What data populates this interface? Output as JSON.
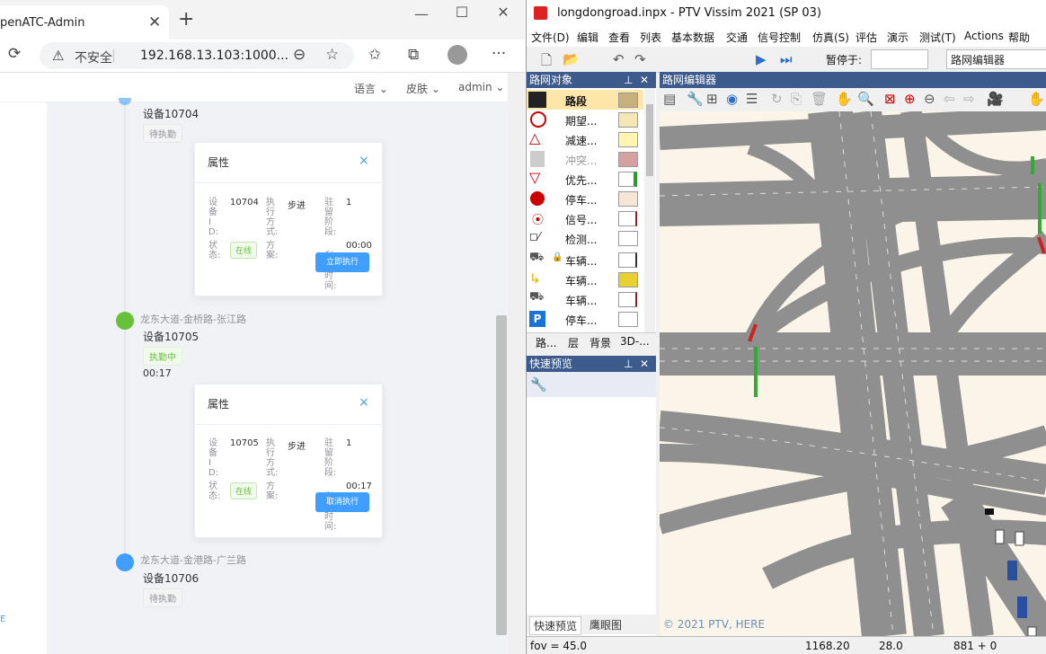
{
  "browser": {
    "tab_title": "penATC-Admin",
    "tab_close": "✕",
    "new_tab": "+",
    "window_controls": {
      "minimize": "—",
      "maximize": "☐",
      "close": "✕"
    },
    "security_label": "不安全",
    "url": "192.168.13.103:1000...",
    "icons": [
      "refresh-icon",
      "warning-icon",
      "zoom-icon",
      "favorite-add-icon",
      "favorites-icon",
      "collections-icon",
      "profile-icon",
      "more-icon"
    ]
  },
  "app": {
    "header": {
      "language": "语言",
      "skin": "皮肤",
      "user": "admin"
    },
    "left_nav_char": "E",
    "timeline": [
      {
        "device": "设备10704",
        "tag": "待执勤",
        "card": {
          "title": "属性",
          "device_id_label": "设备ID:",
          "device_id": "10704",
          "mode_label": "执行方式:",
          "mode": "步进",
          "stage_label": "驻留阶段:",
          "stage": "1",
          "status_label": "状态:",
          "status": "在线",
          "plan_label": "方案:",
          "remain_label": "剩余时间:",
          "remain": "00:00",
          "action": "立即执行"
        }
      },
      {
        "title": "龙东大道-金桥路-张江路",
        "device": "设备10705",
        "tag": "执勤中",
        "elapsed": "00:17",
        "card": {
          "title": "属性",
          "device_id_label": "设备ID:",
          "device_id": "10705",
          "mode_label": "执行方式:",
          "mode": "步进",
          "stage_label": "驻留阶段:",
          "stage": "1",
          "status_label": "状态:",
          "status": "在线",
          "plan_label": "方案:",
          "remain_label": "剩余时间:",
          "remain": "00:17",
          "action": "取消执行"
        }
      },
      {
        "title": "龙东大道-金港路-广兰路",
        "device": "设备10706",
        "tag": "待执勤"
      }
    ]
  },
  "vissim": {
    "title": "longdongroad.inpx - PTV Vissim 2021 (SP 03)",
    "menu": [
      "文件(D)",
      "编辑",
      "查看",
      "列表",
      "基本数据",
      "交通",
      "信号控制",
      "仿真(S)",
      "评估",
      "演示",
      "测试(T)",
      "Actions",
      "帮助"
    ],
    "toolbar": {
      "pause_label": "暂停于:",
      "editor_name": "路网编辑器"
    },
    "network_objects": {
      "header": "路网对象",
      "items": [
        {
          "label": "路段",
          "icon": "link-icon",
          "swatch": "#c8b07a"
        },
        {
          "label": "期望...",
          "icon": "speed-50-icon",
          "swatch": "#f2e7b5"
        },
        {
          "label": "减速...",
          "icon": "reduce-speed-icon",
          "swatch": "#fff7b0"
        },
        {
          "label": "冲突...",
          "icon": "conflict-icon",
          "swatch": "#d4a0a0",
          "disabled": true
        },
        {
          "label": "优先...",
          "icon": "priority-icon",
          "swatch": "#2a9a2a"
        },
        {
          "label": "停车...",
          "icon": "stop-sign-icon",
          "swatch": "#e8c8a8"
        },
        {
          "label": "信号...",
          "icon": "signal-head-icon",
          "swatch": "#9a2020"
        },
        {
          "label": "检测...",
          "icon": "detector-icon",
          "swatch": "#ffffff"
        },
        {
          "label": "车辆...",
          "icon": "vehicle-input-icon",
          "swatch": "#333333",
          "locked": true
        },
        {
          "label": "车辆...",
          "icon": "vehicle-route-icon",
          "swatch": "#e8d030"
        },
        {
          "label": "车辆...",
          "icon": "vehicle-composition-icon",
          "swatch": "#9a2020"
        },
        {
          "label": "停车...",
          "icon": "parking-icon",
          "swatch": "#ffffff"
        }
      ],
      "tabs": [
        "路...",
        "层",
        "背景",
        "3D-..."
      ]
    },
    "quick_view": {
      "header": "快速预览",
      "tabs": [
        "快速预览",
        "鹰眼图"
      ]
    },
    "network_editor": {
      "header": "路网编辑器",
      "copyright": "© 2021 PTV, HERE"
    },
    "status": {
      "fov": "fov = 45.0",
      "x": "1168.20",
      "y": "28.0",
      "time": "881 + 0"
    }
  }
}
